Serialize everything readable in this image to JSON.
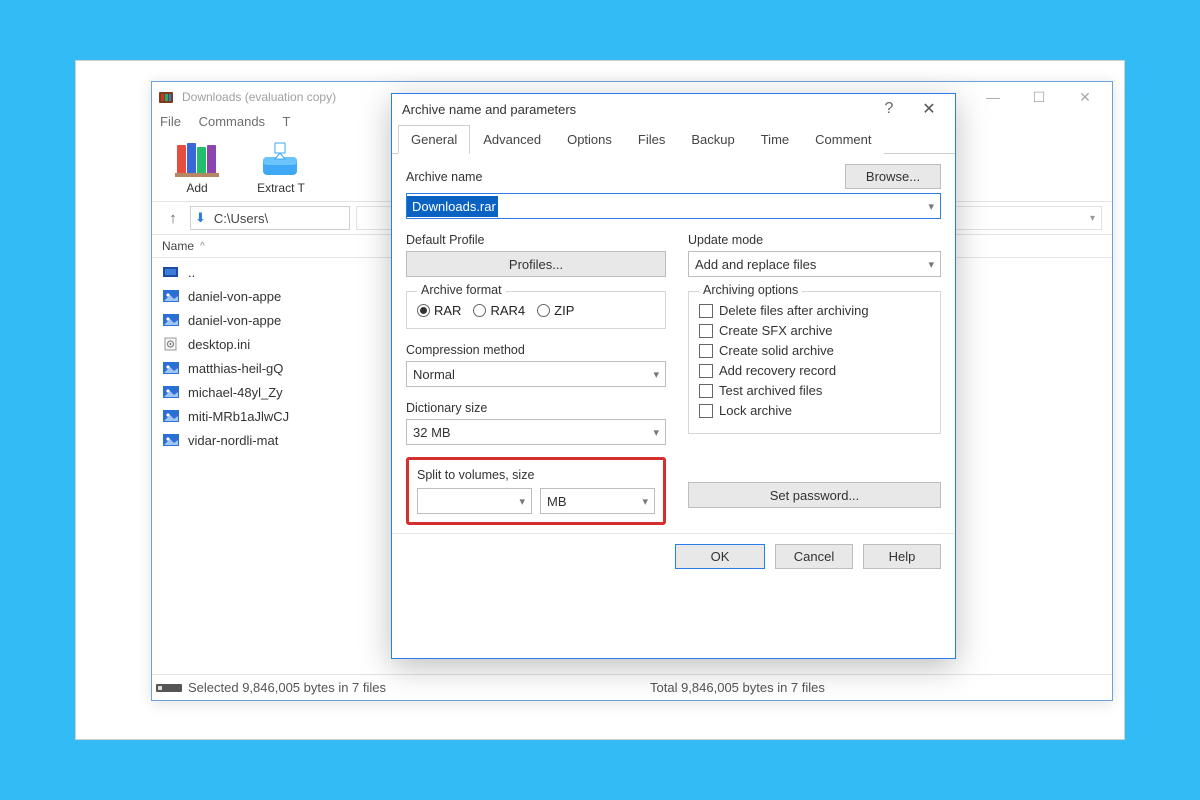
{
  "main_window": {
    "title": "Downloads (evaluation copy)",
    "menu": [
      "File",
      "Commands",
      "T"
    ],
    "toolbar": {
      "add": "Add",
      "extract": "Extract T"
    },
    "path_input": "C:\\Users\\",
    "columns": {
      "name": "Name"
    },
    "files": [
      {
        "icon": "up",
        "label": ".."
      },
      {
        "icon": "image",
        "label": "daniel-von-appe"
      },
      {
        "icon": "image",
        "label": "daniel-von-appe"
      },
      {
        "icon": "ini",
        "label": "desktop.ini"
      },
      {
        "icon": "image",
        "label": "matthias-heil-gQ"
      },
      {
        "icon": "image",
        "label": "michael-48yl_Zy"
      },
      {
        "icon": "image",
        "label": "miti-MRb1aJlwCJ"
      },
      {
        "icon": "image",
        "label": "vidar-nordli-mat"
      }
    ],
    "statusbar": {
      "left": "Selected 9,846,005 bytes in 7 files",
      "right": "Total 9,846,005 bytes in 7 files"
    }
  },
  "dialog": {
    "title": "Archive name and parameters",
    "tabs": [
      "General",
      "Advanced",
      "Options",
      "Files",
      "Backup",
      "Time",
      "Comment"
    ],
    "active_tab": "General",
    "archive_name_label": "Archive name",
    "browse": "Browse...",
    "archive_name": "Downloads.rar",
    "default_profile_label": "Default Profile",
    "profiles_btn": "Profiles...",
    "update_mode_label": "Update mode",
    "update_mode": "Add and replace files",
    "archive_format_label": "Archive format",
    "formats": {
      "rar": "RAR",
      "rar4": "RAR4",
      "zip": "ZIP"
    },
    "archiving_options_label": "Archiving options",
    "options": {
      "delete": "Delete files after archiving",
      "sfx": "Create SFX archive",
      "solid": "Create solid archive",
      "recovery": "Add recovery record",
      "test": "Test archived files",
      "lock": "Lock archive"
    },
    "compression_label": "Compression method",
    "compression": "Normal",
    "dictionary_label": "Dictionary size",
    "dictionary": "32 MB",
    "split_label": "Split to volumes, size",
    "split_value": "",
    "split_unit": "MB",
    "set_password": "Set password...",
    "buttons": {
      "ok": "OK",
      "cancel": "Cancel",
      "help": "Help"
    }
  }
}
